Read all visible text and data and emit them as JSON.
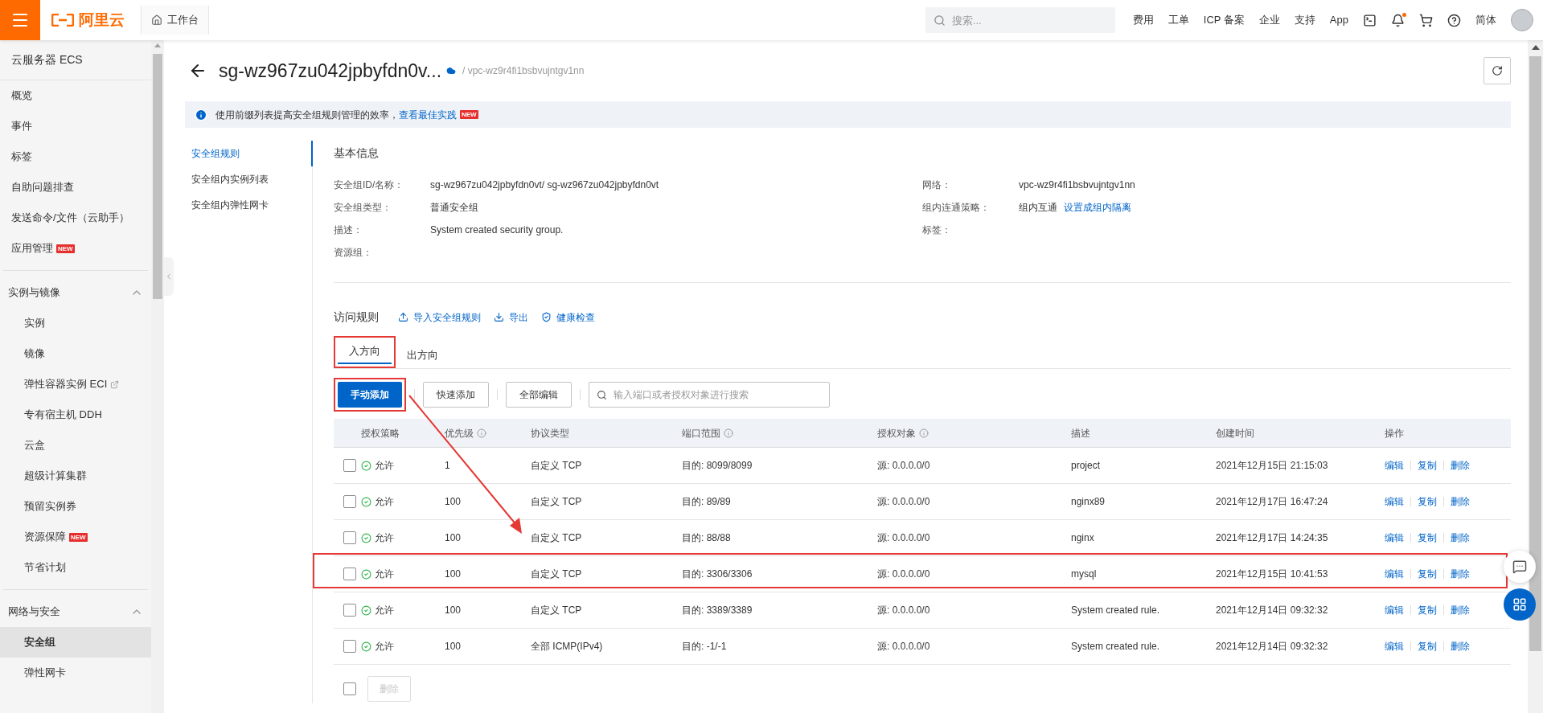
{
  "topbar": {
    "logo": "阿里云",
    "workbench": "工作台",
    "search": {
      "placeholder": "搜索..."
    },
    "links": [
      "费用",
      "工单",
      "ICP 备案",
      "企业",
      "支持",
      "App"
    ],
    "bell": {
      "unread": true
    },
    "language": "简体"
  },
  "sidebar": {
    "title": "云服务器 ECS",
    "items": [
      {
        "label": "概览",
        "selected": false
      },
      {
        "label": "事件",
        "selected": false
      },
      {
        "label": "标签",
        "selected": false
      },
      {
        "label": "自助问题排查",
        "selected": false
      },
      {
        "label": "发送命令/文件（云助手）",
        "selected": false
      },
      {
        "label": "应用管理",
        "badge": "NEW",
        "selected": false
      }
    ],
    "sections": [
      {
        "label": "实例与镜像",
        "expanded": true,
        "items": [
          {
            "label": "实例",
            "selected": false
          },
          {
            "label": "镜像",
            "selected": false
          },
          {
            "label": "弹性容器实例 ECI",
            "external": true,
            "selected": false
          },
          {
            "label": "专有宿主机 DDH",
            "selected": false
          },
          {
            "label": "云盒",
            "selected": false
          },
          {
            "label": "超级计算集群",
            "selected": false
          },
          {
            "label": "预留实例券",
            "selected": false
          },
          {
            "label": "资源保障",
            "badge": "NEW",
            "selected": false
          },
          {
            "label": "节省计划",
            "selected": false
          }
        ]
      },
      {
        "label": "网络与安全",
        "expanded": true,
        "items": [
          {
            "label": "安全组",
            "selected": true
          },
          {
            "label": "弹性网卡",
            "selected": false
          }
        ]
      }
    ]
  },
  "header": {
    "title": "sg-wz967zu042jpbyfdn0v...",
    "vpc": "/ vpc-wz9r4fi1bsbvujntgv1nn"
  },
  "notice": {
    "text": "使用前缀列表提高安全组规则管理的效率，",
    "link": "查看最佳实践",
    "badge": "NEW"
  },
  "subnav": [
    {
      "label": "安全组规则",
      "selected": true
    },
    {
      "label": "安全组内实例列表",
      "selected": false
    },
    {
      "label": "安全组内弹性网卡",
      "selected": false
    }
  ],
  "basic_info": {
    "title": "基本信息",
    "left": [
      {
        "label": "安全组ID/名称：",
        "value": "sg-wz967zu042jpbyfdn0vt/ sg-wz967zu042jpbyfdn0vt"
      },
      {
        "label": "安全组类型：",
        "value": "普通安全组"
      },
      {
        "label": "描述：",
        "value": "System created security group."
      },
      {
        "label": "资源组："
      }
    ],
    "right": [
      {
        "label": "网络：",
        "value": "vpc-wz9r4fi1bsbvujntgv1nn"
      },
      {
        "label": "组内连通策略：",
        "value": "组内互通",
        "link": "设置成组内隔离"
      },
      {
        "label": "标签："
      }
    ]
  },
  "access_rules": {
    "title": "访问规则",
    "actions": [
      {
        "label": "导入安全组规则",
        "kind": "import"
      },
      {
        "label": "导出",
        "kind": "export"
      },
      {
        "label": "健康检查",
        "kind": "check"
      }
    ],
    "tabs": [
      {
        "label": "入方向",
        "selected": true,
        "highlighted": true
      },
      {
        "label": "出方向",
        "selected": false,
        "highlighted": false
      }
    ],
    "buttons": [
      {
        "label": "手动添加",
        "kind": "primary",
        "highlighted": true
      },
      {
        "label": "快速添加",
        "kind": "default",
        "highlighted": false
      },
      {
        "label": "全部编辑",
        "kind": "default",
        "highlighted": false
      }
    ],
    "search": {
      "placeholder": "输入端口或者授权对象进行搜索"
    },
    "columns": [
      {
        "label": "授权策略",
        "info": false
      },
      {
        "label": "优先级",
        "info": true
      },
      {
        "label": "协议类型",
        "info": false
      },
      {
        "label": "端口范围",
        "info": true
      },
      {
        "label": "授权对象",
        "info": true
      },
      {
        "label": "描述",
        "info": false
      },
      {
        "label": "创建时间",
        "info": false
      },
      {
        "label": "操作",
        "info": false
      }
    ],
    "rows": [
      {
        "checked": false,
        "highlighted": false,
        "policy": "允许",
        "priority": "1",
        "protocol": "自定义 TCP",
        "port": "目的: 8099/8099",
        "source": "源: 0.0.0.0/0",
        "description": "project",
        "created": "2021年12月15日 21:15:03",
        "actions": [
          "编辑",
          "复制",
          "删除"
        ]
      },
      {
        "checked": false,
        "highlighted": false,
        "policy": "允许",
        "priority": "100",
        "protocol": "自定义 TCP",
        "port": "目的: 89/89",
        "source": "源: 0.0.0.0/0",
        "description": "nginx89",
        "created": "2021年12月17日 16:47:24",
        "actions": [
          "编辑",
          "复制",
          "删除"
        ]
      },
      {
        "checked": false,
        "highlighted": false,
        "policy": "允许",
        "priority": "100",
        "protocol": "自定义 TCP",
        "port": "目的: 88/88",
        "source": "源: 0.0.0.0/0",
        "description": "nginx",
        "created": "2021年12月17日 14:24:35",
        "actions": [
          "编辑",
          "复制",
          "删除"
        ]
      },
      {
        "checked": false,
        "highlighted": true,
        "policy": "允许",
        "priority": "100",
        "protocol": "自定义 TCP",
        "port": "目的: 3306/3306",
        "source": "源: 0.0.0.0/0",
        "description": "mysql",
        "created": "2021年12月15日 10:41:53",
        "actions": [
          "编辑",
          "复制",
          "删除"
        ]
      },
      {
        "checked": false,
        "highlighted": false,
        "policy": "允许",
        "priority": "100",
        "protocol": "自定义 TCP",
        "port": "目的: 3389/3389",
        "source": "源: 0.0.0.0/0",
        "description": "System created rule.",
        "created": "2021年12月14日 09:32:32",
        "actions": [
          "编辑",
          "复制",
          "删除"
        ]
      },
      {
        "checked": false,
        "highlighted": false,
        "policy": "允许",
        "priority": "100",
        "protocol": "全部 ICMP(IPv4)",
        "port": "目的: -1/-1",
        "source": "源: 0.0.0.0/0",
        "description": "System created rule.",
        "created": "2021年12月14日 09:32:32",
        "actions": [
          "编辑",
          "复制",
          "删除"
        ]
      }
    ],
    "footer": {
      "checked": false,
      "delete_button": {
        "label": "删除",
        "disabled": true
      }
    }
  }
}
